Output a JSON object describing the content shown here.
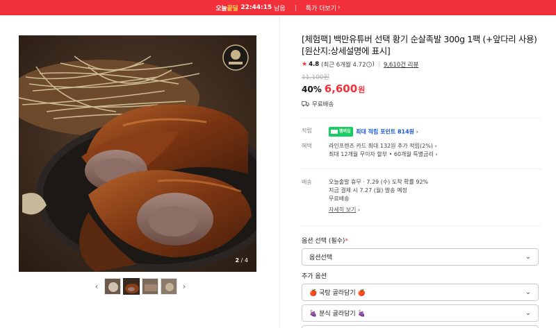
{
  "topbar": {
    "brand_main": "오늘",
    "brand_hl": "끝딜",
    "timer": "22:44:15",
    "timer_suffix": "남음",
    "more_label": "특가 더보기",
    "more_chevron": "›"
  },
  "gallery": {
    "image_icon": "braised-pork-trotter-photo",
    "badge_icon": "chef-logo-badge",
    "page_current": "2",
    "page_total": "/ 4",
    "prev_label": "‹",
    "next_label": "›",
    "thumbs": [
      "thumb-1",
      "thumb-2",
      "thumb-3",
      "thumb-4"
    ],
    "active_thumb": 1
  },
  "product": {
    "title_line1": "[체험팩] 백만유튜버 선택 황기 순살족발 300g 1팩 (+앞다리 사용)",
    "title_line2": "[원산지:상세설명에 표시]",
    "rating": "4.8",
    "rating_detail": "(최근 6개월 4.72",
    "rating_detail_end": ")",
    "reviews": "9,610건 리뷰",
    "original_price": "11,100원",
    "discount": "40%",
    "price": "6,600",
    "price_unit": "원",
    "shipping": "무료배송"
  },
  "benefits": {
    "points_label": "적립",
    "points_badge": "멤버십",
    "points_text": "최대 적립 포인트 814원",
    "points_chevron": "›",
    "benefit_label": "혜택",
    "benefit_line1": "라인프렌즈 카드 최대 132원 추가 적립(2%) ›",
    "benefit_line2": "최대 12개월 무이자 할부 • 60개월 특별금리 ›"
  },
  "delivery": {
    "label": "배송",
    "line1": "오늘출발 휴무 · 7.29 (수) 도착 확률 92%",
    "line2": "지금 결제 시 7.27 (월) 발송 예정",
    "line3": "무료배송",
    "details_link": "자세히 보기",
    "details_chevron": "›"
  },
  "options": {
    "required_label": "옵션 선택 (필수)",
    "required_mark": "*",
    "required_value": "옵션선택",
    "extra_label": "추가 옵션",
    "extra1": "🍎 국탕 골라담기 🍎",
    "extra2": "🍇 분식 골라담기 🍇"
  },
  "colors": {
    "accent": "#f2303a",
    "link_blue": "#1a56d6",
    "npay_green": "#19ce60"
  }
}
